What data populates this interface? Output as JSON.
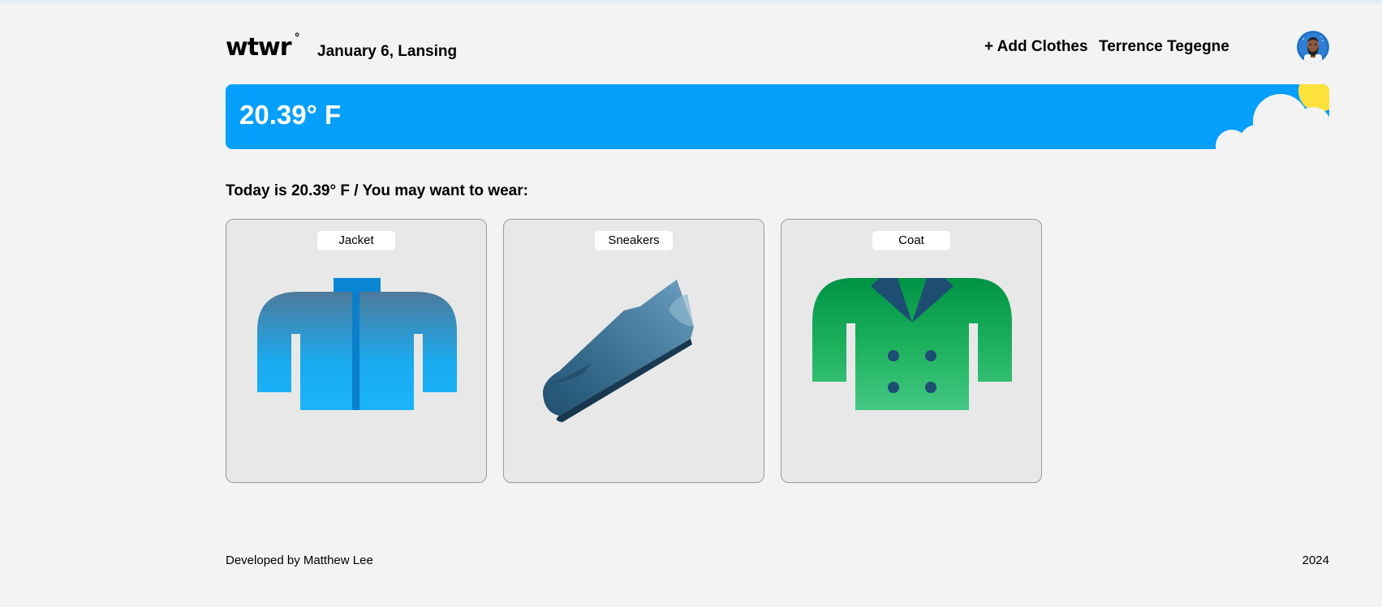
{
  "header": {
    "logo_text": "wtwr",
    "logo_mark": "°",
    "date_location": "January 6, Lansing",
    "add_clothes_label": "+ Add Clothes",
    "username": "Terrence Tegegne",
    "avatar_icon": "user-avatar"
  },
  "weather": {
    "temperature": "20.39° F",
    "condition_icon": "sun-cloud-icon",
    "banner_color": "#069ffb"
  },
  "main": {
    "intro": "Today is 20.39° F / You may want to wear:",
    "cards": [
      {
        "label": "Jacket",
        "icon": "jacket-icon"
      },
      {
        "label": "Sneakers",
        "icon": "sneaker-icon"
      },
      {
        "label": "Coat",
        "icon": "coat-icon"
      }
    ]
  },
  "footer": {
    "developer": "Developed by Matthew Lee",
    "year": "2024"
  }
}
